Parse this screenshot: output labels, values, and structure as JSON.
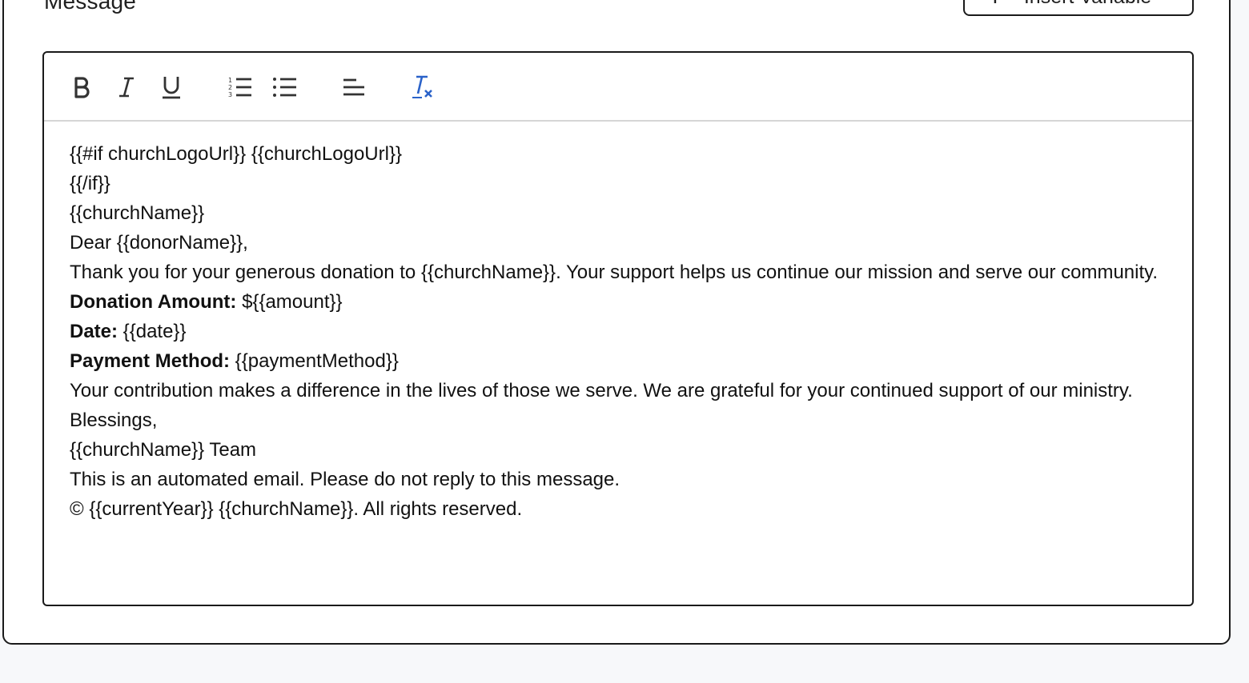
{
  "section": {
    "title": "Message",
    "insert_variable_label": "Insert Variable"
  },
  "toolbar": {
    "buttons": [
      {
        "name": "bold",
        "icon": "bold-icon"
      },
      {
        "name": "italic",
        "icon": "italic-icon"
      },
      {
        "name": "underline",
        "icon": "underline-icon"
      },
      {
        "name": "ordered-list",
        "icon": "ordered-list-icon"
      },
      {
        "name": "bullet-list",
        "icon": "bullet-list-icon"
      },
      {
        "name": "align",
        "icon": "align-left-icon"
      },
      {
        "name": "clear-format",
        "icon": "clear-format-icon"
      }
    ],
    "accent_color": "#2a62c9"
  },
  "body": {
    "line1": "{{#if churchLogoUrl}} {{churchLogoUrl}}",
    "line2": "{{/if}}",
    "line3": "{{churchName}}",
    "line4": "Dear {{donorName}},",
    "line5": "Thank you for your generous donation to {{churchName}}. Your support helps us continue our mission and serve our community.",
    "amount_label": "Donation Amount:",
    "amount_value": " ${{amount}}",
    "date_label": "Date:",
    "date_value": " {{date}}",
    "payment_label": "Payment Method:",
    "payment_value": " {{paymentMethod}}",
    "line9": "Your contribution makes a difference in the lives of those we serve. We are grateful for your continued support of our ministry.",
    "line10": "Blessings,",
    "line11": "{{churchName}} Team",
    "line12": "This is an automated email. Please do not reply to this message.",
    "line13": "© {{currentYear}} {{churchName}}. All rights reserved."
  }
}
